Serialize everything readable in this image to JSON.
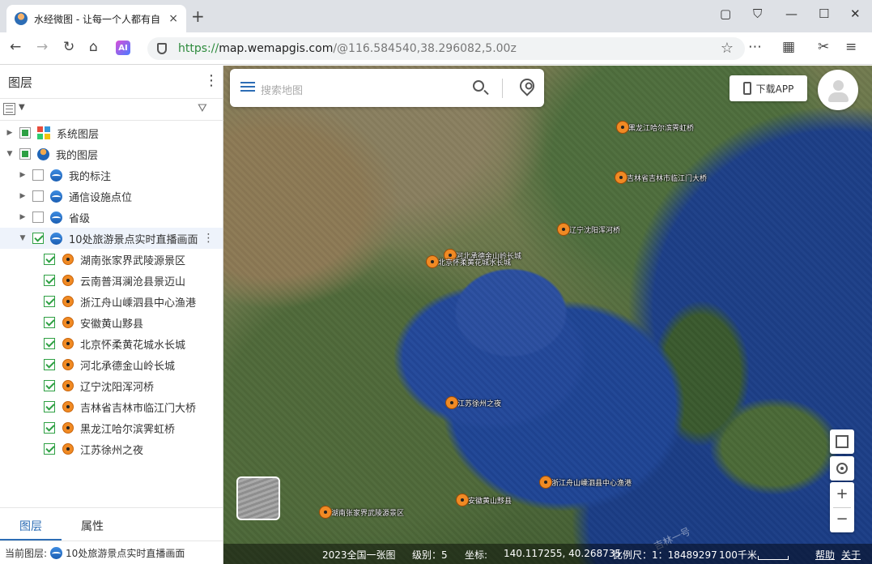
{
  "browser": {
    "tab_title": "水经微图 - 让每一个人都有自",
    "tab_close": "×",
    "new_tab": "+",
    "url_scheme": "https://",
    "url_host": "map.wemapgis.com",
    "url_path": "/@116.584540,38.296082,5.00z",
    "ai_label": "AI"
  },
  "panel": {
    "title": "图层",
    "menu_glyph": "⋮",
    "tree": {
      "system_layers": "系统图层",
      "my_layers": "我的图层",
      "my_marks": "我的标注",
      "telecom_points": "通信设施点位",
      "province": "省级",
      "scenic_live": "10处旅游景点实时直播画面"
    },
    "scenic_items": [
      "湖南张家界武陵源景区",
      "云南普洱澜沧县景迈山",
      "浙江舟山嵊泗县中心渔港",
      "安徽黄山黟县",
      "北京怀柔黄花城水长城",
      "河北承德金山岭长城",
      "辽宁沈阳浑河桥",
      "吉林省吉林市临江门大桥",
      "黑龙江哈尔滨霁虹桥",
      "江苏徐州之夜"
    ],
    "tabs": {
      "layers": "图层",
      "properties": "属性"
    },
    "current_layer_label": "当前图层:",
    "current_layer_value": "10处旅游景点实时直播画面"
  },
  "map": {
    "search_placeholder": "搜索地图",
    "download_app": "下载APP",
    "watermark": "吉林一号",
    "markers": [
      "黑龙江哈尔滨霁虹桥",
      "吉林省吉林市临江门大桥",
      "辽宁沈阳浑河桥",
      "河北承德金山岭长城",
      "北京怀柔黄花城水长城",
      "江苏徐州之夜",
      "浙江舟山嵊泗县中心渔港",
      "安徽黄山黟县",
      "湖南张家界武陵源景区"
    ],
    "zoom_in": "+",
    "zoom_out": "−",
    "status": {
      "basemap": "2023全国一张图",
      "level": "级别：5",
      "coord_label": "坐标:",
      "coord_value": "140.117255, 40.268735",
      "scale": "比例尺：1：18489297",
      "scale_bar": "100千米",
      "help": "帮助",
      "about": "关于"
    }
  },
  "colors": {
    "accent": "#2d6db5",
    "check": "#2ea043",
    "marker": "#f08a24"
  }
}
